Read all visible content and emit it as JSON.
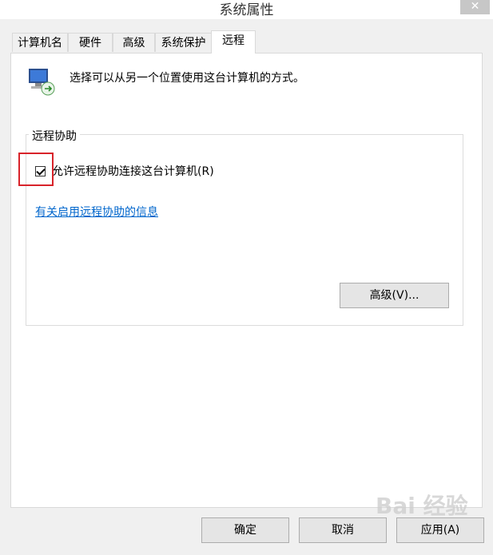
{
  "window": {
    "title": "系统属性",
    "close_glyph": "✕"
  },
  "tabs": [
    {
      "label": "计算机名",
      "active": false
    },
    {
      "label": "硬件",
      "active": false
    },
    {
      "label": "高级",
      "active": false
    },
    {
      "label": "系统保护",
      "active": false
    },
    {
      "label": "远程",
      "active": true
    }
  ],
  "remote_tab": {
    "intro_text": "选择可以从另一个位置使用这台计算机的方式。",
    "remote_assistance": {
      "group_title": "远程协助",
      "checkbox_label": "允许远程协助连接这台计算机(R)",
      "checked": true,
      "help_link": "有关启用远程协助的信息",
      "advanced_button": "高级(V)..."
    }
  },
  "footer": {
    "ok": "确定",
    "cancel": "取消",
    "apply": "应用(A)"
  },
  "watermark": "Bai 经验",
  "colors": {
    "highlight_box": "#d8232a",
    "link": "#0066cc"
  }
}
